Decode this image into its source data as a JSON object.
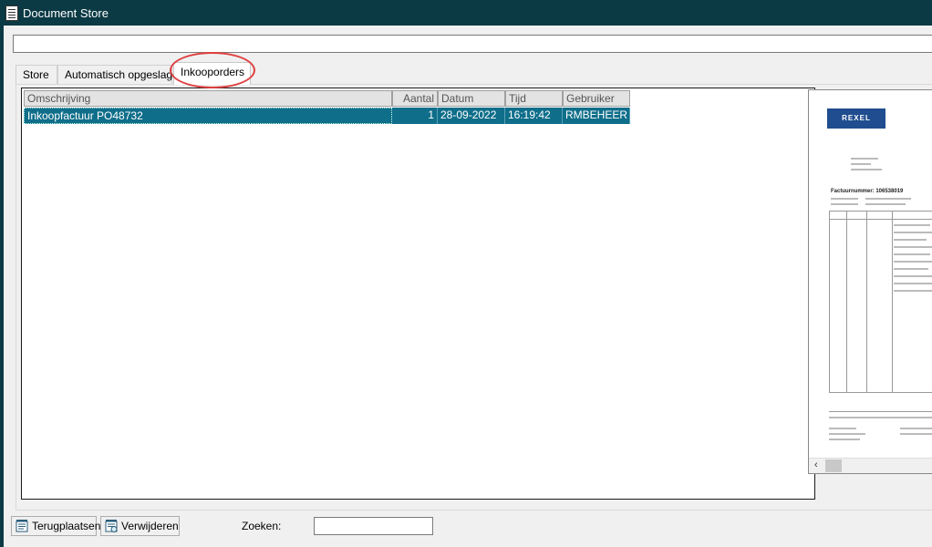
{
  "window": {
    "title": "Document Store",
    "icon": "document-list-icon"
  },
  "top_field": {
    "value": ""
  },
  "tabs": [
    {
      "label": "Store",
      "active": false
    },
    {
      "label": "Automatisch opgeslagen",
      "active": false
    },
    {
      "label": "Inkooporders",
      "active": true
    }
  ],
  "grid": {
    "columns": [
      "Omschrijving",
      "Aantal",
      "Datum",
      "Tijd",
      "Gebruiker"
    ],
    "rows": [
      {
        "omschrijving": "Inkoopfactuur PO48732",
        "aantal": "1",
        "datum": "28-09-2022",
        "tijd": "16:19:42",
        "gebruiker": "RMBEHEER",
        "selected": true
      }
    ]
  },
  "preview": {
    "logo_text": "REXEL",
    "invoice_label": "Factuurnummer: 106538019",
    "scroll_left_arrow": "‹"
  },
  "buttons": {
    "terugplaatsen": "Terugplaatsen",
    "verwijderen": "Verwijderen"
  },
  "search": {
    "label": "Zoeken:",
    "value": ""
  },
  "colors": {
    "titlebar": "#0b3a45",
    "selection": "#0f6e8a",
    "highlight_oval": "#e04040"
  }
}
